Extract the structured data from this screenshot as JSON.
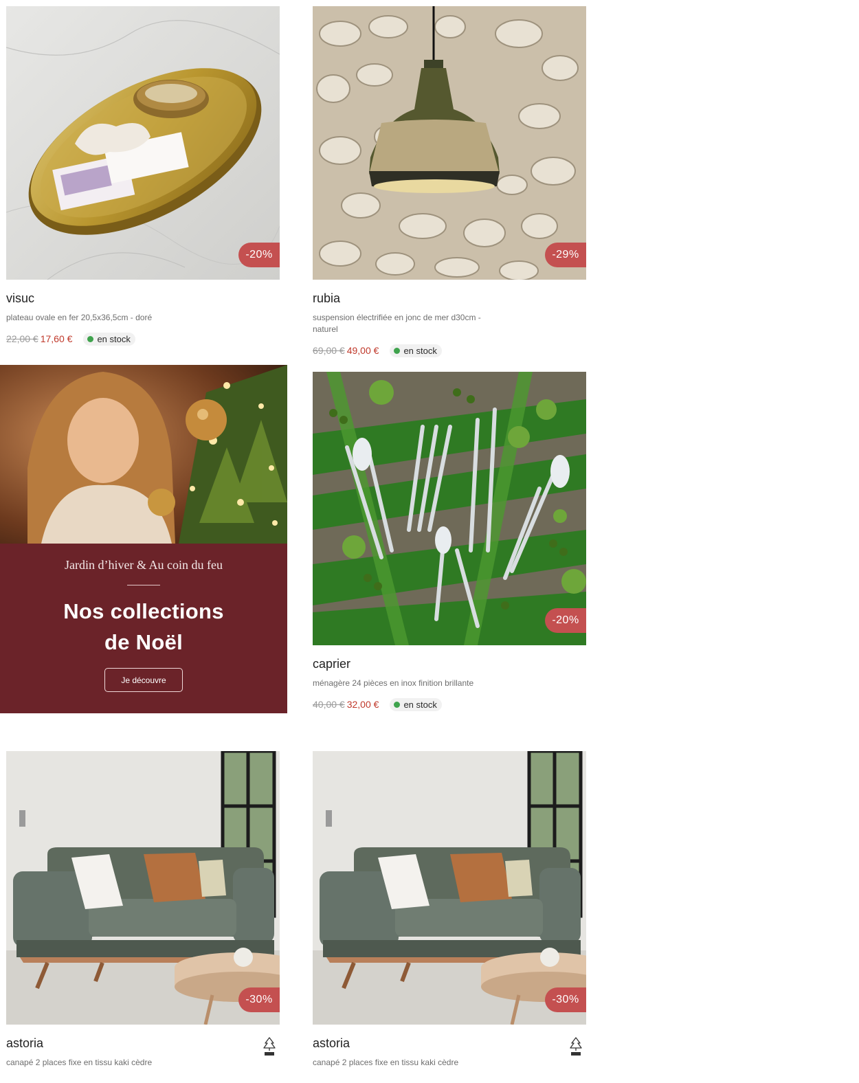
{
  "products": [
    {
      "name": "visuc",
      "description": "plateau ovale en fer 20,5x36,5cm - doré",
      "old_price": "22,00 €",
      "price": "17,60 €",
      "discount": "-20%",
      "stock": "en stock",
      "image_icon": "gold-tray-image"
    },
    {
      "name": "rubia",
      "description": "suspension électrifiée en jonc de mer d30cm - naturel",
      "old_price": "69,00 €",
      "price": "49,00 €",
      "discount": "-29%",
      "stock": "en stock",
      "image_icon": "pendant-lamp-image"
    },
    {
      "name": "caprier",
      "description": "ménagère 24 pièces en inox finition brillante",
      "old_price": "40,00 €",
      "price": "32,00 €",
      "discount": "-20%",
      "stock": "en stock",
      "image_icon": "cutlery-set-image"
    },
    {
      "name": "astoria",
      "description": "canapé 2 places fixe en tissu kaki cèdre",
      "discount": "-30%",
      "image_icon": "sofa-image",
      "fsc_icon": "fsc-tree-icon"
    },
    {
      "name": "astoria",
      "description": "canapé 2 places fixe en tissu kaki cèdre",
      "discount": "-30%",
      "image_icon": "sofa-image",
      "fsc_icon": "fsc-tree-icon"
    }
  ],
  "promo": {
    "subtitle": "Jardin d’hiver & Au coin du feu",
    "title_line1": "Nos collections",
    "title_line2": "de Noël",
    "button": "Je découvre"
  },
  "colors": {
    "discount_badge": "#c45050",
    "sale_price": "#c0392b",
    "stock_dot": "#3fa34d",
    "promo_background": "#6b2329"
  }
}
